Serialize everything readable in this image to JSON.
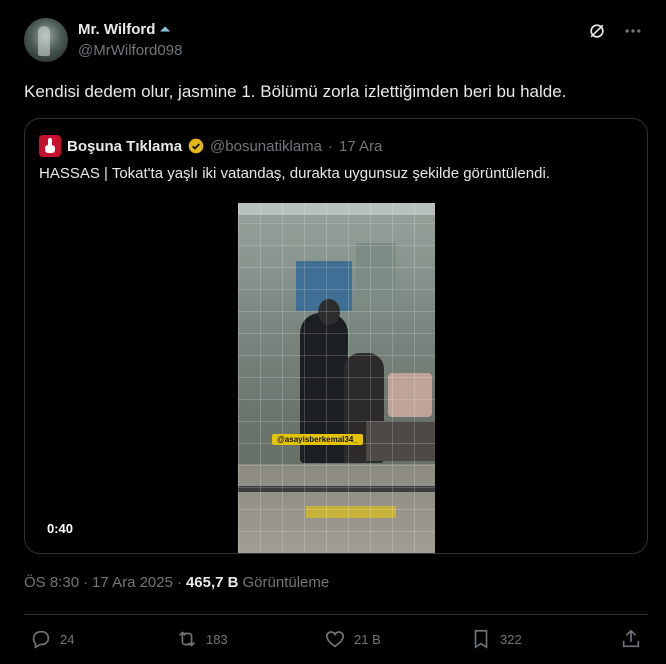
{
  "author": {
    "name": "Mr. Wilford",
    "handle": "@MrWilford098",
    "name_icon": "pyramid-icon"
  },
  "tweet": {
    "text": "Kendisi dedem olur, jasmine 1. Bölümü zorla izlettiğimden beri bu halde."
  },
  "quote": {
    "name": "Boşuna Tıklama",
    "handle": "@bosunatiklama",
    "separator": "·",
    "date": "17 Ara",
    "text": "HASSAS | Tokat'ta yaşlı iki vatandaş, durakta uygunsuz şekilde görüntülendi.",
    "video": {
      "duration": "0:40",
      "watermark": "@asayisberkemal34_"
    }
  },
  "meta": {
    "time": "ÖS 8:30",
    "separator": "·",
    "date": "17 Ara 2025",
    "separator2": "·",
    "views": "465,7 B",
    "views_label": "Görüntüleme"
  },
  "actions": {
    "replies": "24",
    "reposts": "183",
    "likes": "21 B",
    "bookmarks": "322"
  },
  "colors": {
    "background": "#000000",
    "text": "#e7e9ea",
    "secondary": "#71767b",
    "border": "#2f3336",
    "verified": "#e2b719",
    "logo_red": "#c8102e"
  }
}
